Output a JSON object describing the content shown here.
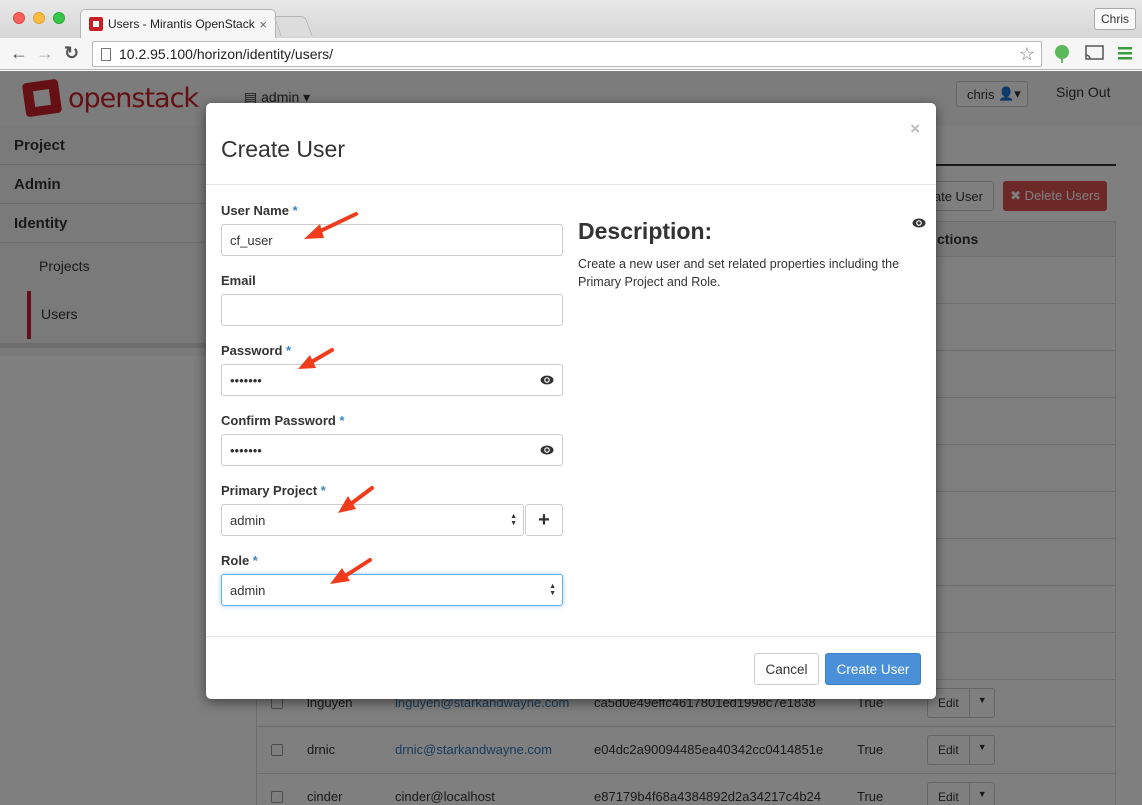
{
  "browser": {
    "tab_title": "Users - Mirantis OpenStack",
    "tab_close": "×",
    "url": "10.2.95.100/horizon/identity/users/",
    "profile_name": "Chris",
    "nav_back": "←",
    "nav_forward": "→",
    "nav_reload": "↻",
    "star": "☆"
  },
  "header": {
    "logo_text": "openstack",
    "project_selector": "admin",
    "user_menu": "chris",
    "sign_out": "Sign Out"
  },
  "sidebar": {
    "items": [
      {
        "label": "Project"
      },
      {
        "label": "Admin"
      },
      {
        "label": "Identity"
      }
    ],
    "sub_items": [
      {
        "label": "Projects"
      },
      {
        "label": "Users"
      }
    ]
  },
  "users_page": {
    "create_button_partial": "ate User",
    "delete_button": "✖ Delete Users",
    "actions_header_partial": "ctions",
    "edit_label": "Edit",
    "rows": [
      {
        "name": "lnguyen",
        "email": "lnguyen@starkandwayne.com",
        "id": "ca5d0e49effc4617801ed1998c7e1838",
        "enabled": "True"
      },
      {
        "name": "drnic",
        "email": "drnic@starkandwayne.com",
        "id": "e04dc2a90094485ea40342cc0414851e",
        "enabled": "True"
      },
      {
        "name": "cinder",
        "email": "cinder@localhost",
        "id": "e87179b4f68a4384892d2a34217c4b24",
        "enabled": "True"
      }
    ]
  },
  "modal": {
    "title": "Create User",
    "close": "×",
    "required_marker": "*",
    "fields": {
      "user_name": {
        "label": "User Name",
        "value": "cf_user"
      },
      "email": {
        "label": "Email",
        "value": ""
      },
      "password": {
        "label": "Password",
        "value": "•••••••"
      },
      "confirm_password": {
        "label": "Confirm Password",
        "value": "•••••••"
      },
      "primary_project": {
        "label": "Primary Project",
        "value": "admin"
      },
      "role": {
        "label": "Role",
        "value": "admin"
      }
    },
    "add_project_button": "+",
    "description": {
      "title": "Description:",
      "text": "Create a new user and set related properties including the Primary Project and Role."
    },
    "cancel_button": "Cancel",
    "create_button": "Create User"
  },
  "colors": {
    "openstack_red": "#c8202a",
    "primary_blue": "#4a90d9",
    "required_blue": "#3a87c8",
    "annotation_arrow": "#f03c1c"
  }
}
